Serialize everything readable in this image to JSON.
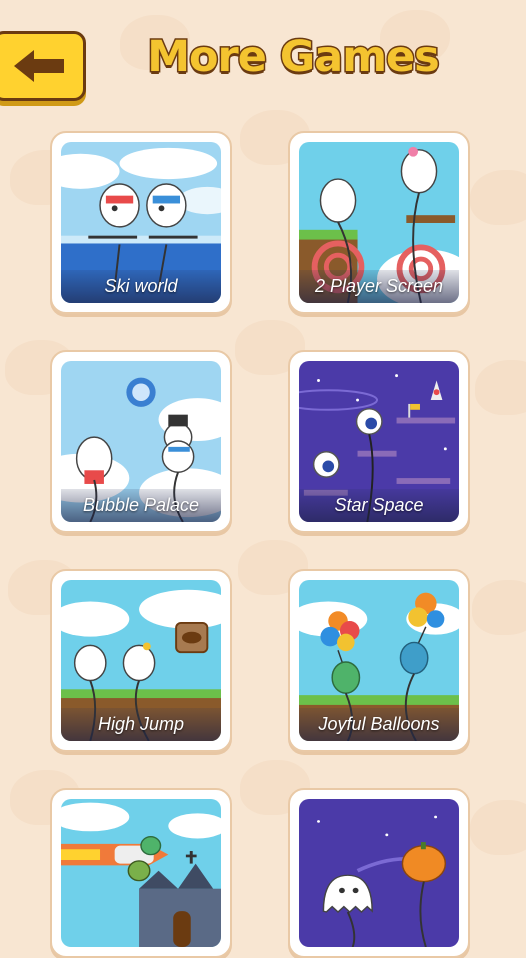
{
  "header": {
    "title": "More Games",
    "back_icon": "arrow-left-icon"
  },
  "colors": {
    "background": "#f8e6d2",
    "title_fill": "#f4c430",
    "title_outline": "#6b3b11",
    "back_button": "#ffd22f"
  },
  "games": [
    {
      "label": "Ski world",
      "theme": "ski"
    },
    {
      "label": "2 Player Screen",
      "theme": "archery"
    },
    {
      "label": "Bubble Palace",
      "theme": "bubble"
    },
    {
      "label": "Star Space",
      "theme": "space"
    },
    {
      "label": "High Jump",
      "theme": "jump"
    },
    {
      "label": "Joyful Balloons",
      "theme": "balloons"
    },
    {
      "label": "",
      "theme": "rocket-castle"
    },
    {
      "label": "",
      "theme": "ghost-pumpkin"
    }
  ]
}
